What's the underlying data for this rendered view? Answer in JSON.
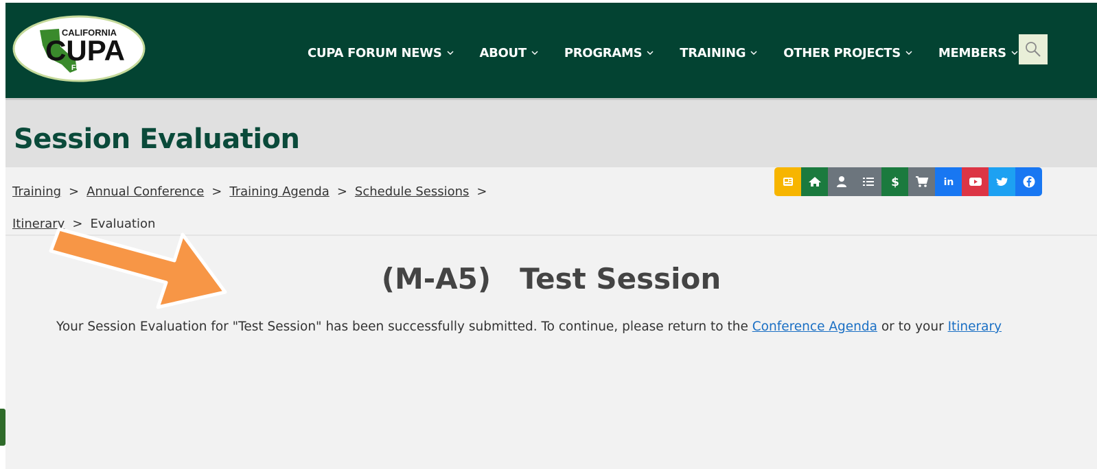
{
  "header": {
    "logo": {
      "top_text": "CALIFORNIA",
      "main_text": "CUPA",
      "bottom_text": "FORUM"
    },
    "nav": [
      {
        "label": "CUPA FORUM NEWS"
      },
      {
        "label": "ABOUT"
      },
      {
        "label": "PROGRAMS"
      },
      {
        "label": "TRAINING"
      },
      {
        "label": "OTHER PROJECTS"
      },
      {
        "label": "MEMBERS"
      }
    ],
    "search_icon": "search-icon"
  },
  "page_title": "Session Evaluation",
  "breadcrumb": {
    "separator": ">",
    "links": [
      "Training",
      "Annual Conference",
      "Training Agenda",
      "Schedule Sessions",
      "Itinerary"
    ],
    "current": "Evaluation"
  },
  "social_bar": [
    {
      "icon": "newspaper-icon",
      "color": "#f7b500"
    },
    {
      "icon": "home-icon",
      "color": "#1b7a3e"
    },
    {
      "icon": "user-icon",
      "color": "#6c757d"
    },
    {
      "icon": "list-icon",
      "color": "#6c757d"
    },
    {
      "icon": "dollar-icon",
      "color": "#1b7a3e"
    },
    {
      "icon": "cart-icon",
      "color": "#6c757d"
    },
    {
      "icon": "linkedin-icon",
      "color": "#1877f2"
    },
    {
      "icon": "youtube-icon",
      "color": "#dc3545"
    },
    {
      "icon": "twitter-icon",
      "color": "#1da1f2"
    },
    {
      "icon": "facebook-icon",
      "color": "#1877f2"
    }
  ],
  "session": {
    "code": "(M-A5)",
    "title": "Test Session"
  },
  "confirmation": {
    "text_before": "Your Session Evaluation for \"Test Session\" has been successfully submitted. To continue, please return to the",
    "link1": "Conference Agenda",
    "text_mid": "or to your",
    "link2": "Itinerary"
  },
  "colors": {
    "header_bg": "#034332",
    "title_color": "#0a4a3a",
    "link_color": "#1a6fc4",
    "arrow_color": "#f79646"
  }
}
